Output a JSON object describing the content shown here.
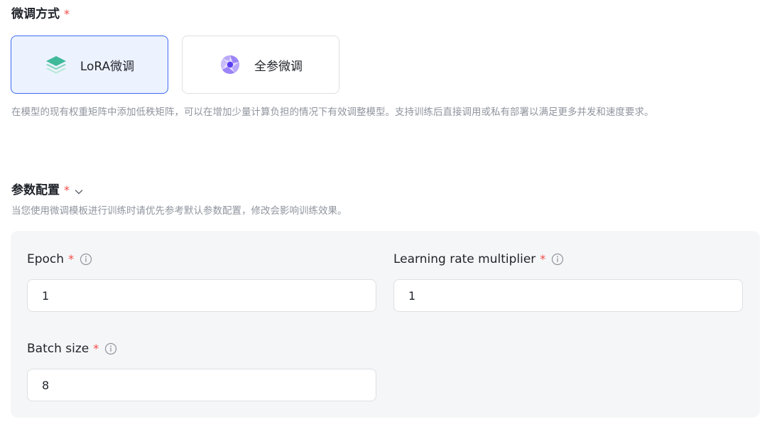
{
  "finetune_method": {
    "title": "微调方式",
    "required_mark": "*",
    "options": [
      {
        "label": "LoRA微调",
        "icon": "layers-icon",
        "selected": true
      },
      {
        "label": "全参微调",
        "icon": "aperture-icon",
        "selected": false
      }
    ],
    "description": "在模型的现有权重矩阵中添加低秩矩阵，可以在增加少量计算负担的情况下有效调整模型。支持训练后直接调用或私有部署以满足更多并发和速度要求。"
  },
  "params": {
    "title": "参数配置",
    "required_mark": "*",
    "hint": "当您使用微调模板进行训练时请优先参考默认参数配置，修改会影响训练效果。",
    "fields": [
      {
        "label": "Epoch",
        "value": "1"
      },
      {
        "label": "Learning rate multiplier",
        "value": "1"
      },
      {
        "label": "Batch size",
        "value": "8"
      }
    ]
  },
  "colors": {
    "accent": "#3d6cf0",
    "required": "#f54a45",
    "layers_icon": "#3fb99a",
    "aperture_icon": "#7b5cf5"
  }
}
